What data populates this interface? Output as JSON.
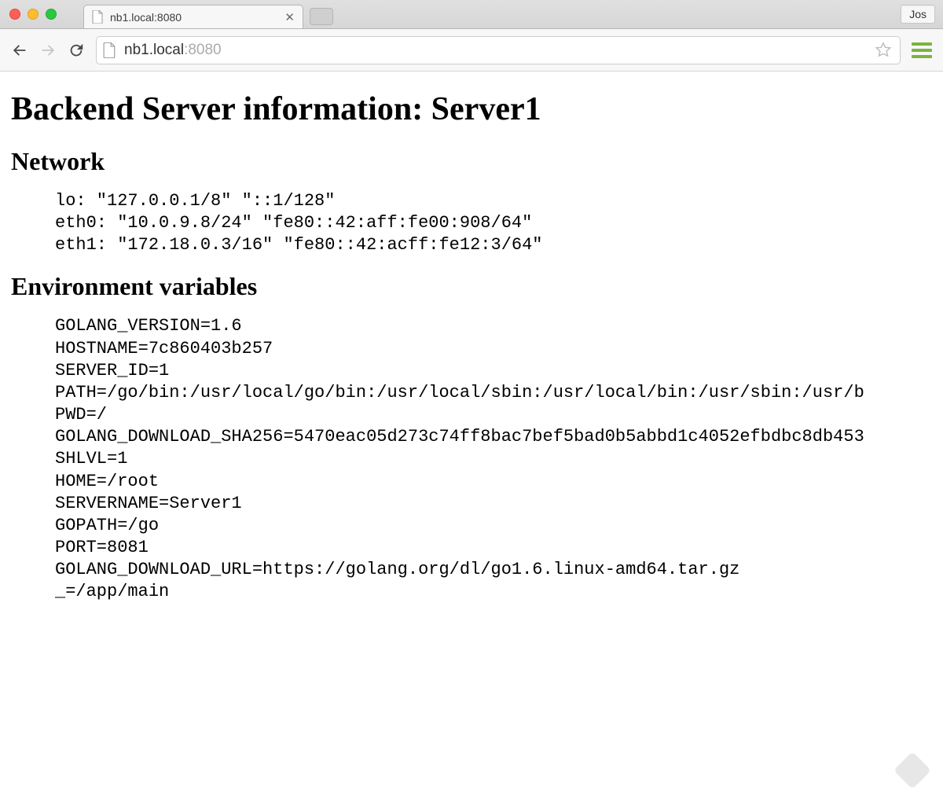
{
  "browser": {
    "tab_title": "nb1.local:8080",
    "url_host": "nb1.local",
    "url_port": ":8080",
    "user_button": "Jos"
  },
  "page": {
    "heading": "Backend Server information: Server1",
    "network_heading": "Network",
    "network_lines": [
      "lo: \"127.0.0.1/8\" \"::1/128\"",
      "eth0: \"10.0.9.8/24\" \"fe80::42:aff:fe00:908/64\"",
      "eth1: \"172.18.0.3/16\" \"fe80::42:acff:fe12:3/64\""
    ],
    "env_heading": "Environment variables",
    "env_lines": [
      "GOLANG_VERSION=1.6",
      "HOSTNAME=7c860403b257",
      "SERVER_ID=1",
      "PATH=/go/bin:/usr/local/go/bin:/usr/local/sbin:/usr/local/bin:/usr/sbin:/usr/b",
      "PWD=/",
      "GOLANG_DOWNLOAD_SHA256=5470eac05d273c74ff8bac7bef5bad0b5abbd1c4052efbdbc8db453",
      "SHLVL=1",
      "HOME=/root",
      "SERVERNAME=Server1",
      "GOPATH=/go",
      "PORT=8081",
      "GOLANG_DOWNLOAD_URL=https://golang.org/dl/go1.6.linux-amd64.tar.gz",
      "_=/app/main"
    ]
  }
}
